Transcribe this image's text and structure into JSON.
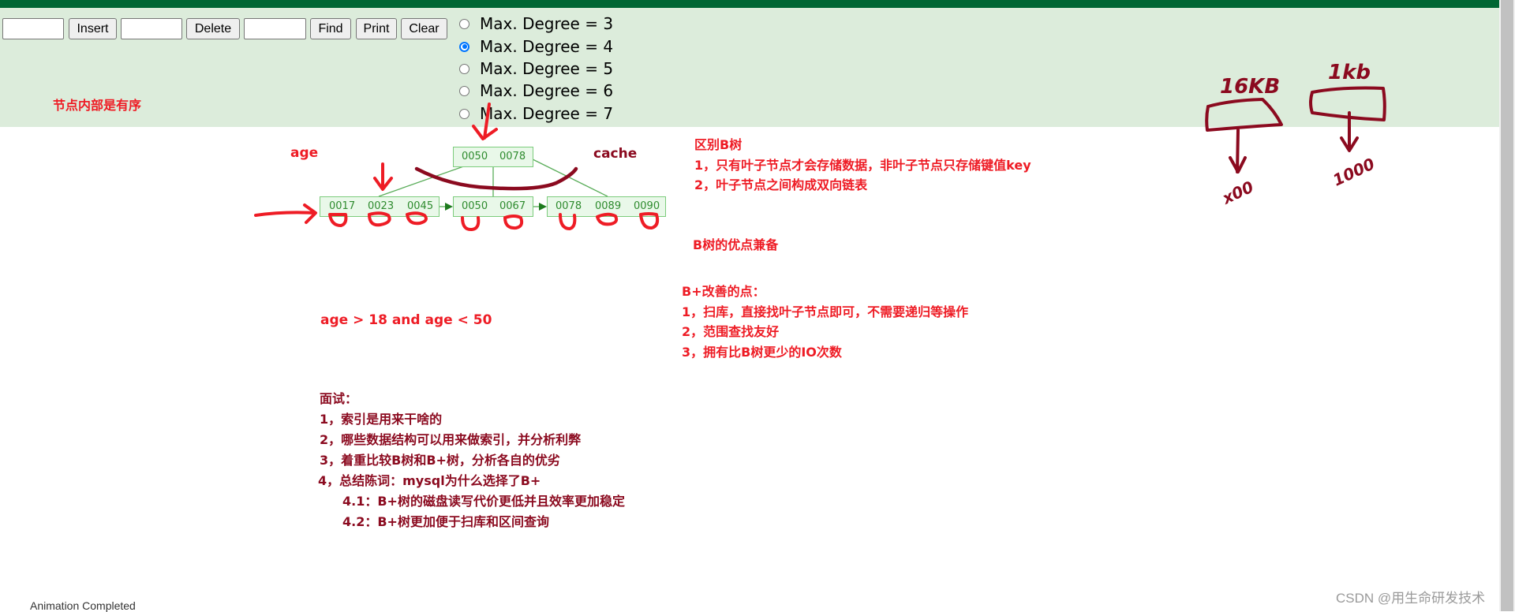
{
  "toolbar": {
    "insert_input_value": "",
    "insert_label": "Insert",
    "delete_input_value": "",
    "delete_label": "Delete",
    "find_input_value": "",
    "find_label": "Find",
    "print_label": "Print",
    "clear_label": "Clear"
  },
  "degree_options": [
    {
      "label": "Max. Degree = 3",
      "checked": false
    },
    {
      "label": "Max. Degree = 4",
      "checked": true
    },
    {
      "label": "Max. Degree = 5",
      "checked": false
    },
    {
      "label": "Max. Degree = 6",
      "checked": false
    },
    {
      "label": "Max. Degree = 7",
      "checked": false
    }
  ],
  "notes": {
    "node_sorted": "节点内部是有序",
    "age_label": "age",
    "cache_label": "cache",
    "range_query": "age > 18 and age < 50",
    "diff_title": "区别B树",
    "diff_lines": [
      "1，只有叶子节点才会存储数据，非叶子节点只存储键值key",
      "2，叶子节点之间构成双向链表"
    ],
    "b_tree_merits": "B树的优点兼备",
    "improve_title": "B+改善的点：",
    "improve_lines": [
      "1，扫库，直接找叶子节点即可，不需要递归等操作",
      "2，范围查找友好",
      "3，拥有比B树更少的IO次数"
    ],
    "interview_title": "面试：",
    "interview_lines": [
      "1，索引是用来干啥的",
      "2，哪些数据结构可以用来做索引，并分析利弊",
      "3，着重比较B树和B+树，分析各自的优劣",
      "4，总结陈词：mysql为什么选择了B+"
    ],
    "interview_sub_lines": [
      "4.1：B+树的磁盘读写代价更低并且效率更加稳定",
      "4.2：B+树更加便于扫库和区间查询"
    ]
  },
  "handwriting": {
    "left_box_label": "16KB",
    "left_box_count": "x00",
    "right_box_label": "1kb",
    "right_box_count": "1000"
  },
  "tree": {
    "root": [
      "0050",
      "0078"
    ],
    "leaves": [
      [
        "0017",
        "0023",
        "0045"
      ],
      [
        "0050",
        "0067"
      ],
      [
        "0078",
        "0089",
        "0090"
      ]
    ]
  },
  "status_text": "Animation Completed",
  "watermark": "CSDN @用生命研发技术",
  "colors": {
    "top_bar": "#006633",
    "panel": "#dcecdb",
    "note_red": "#ee1c25",
    "note_maroon": "#8b0a1f",
    "node_border": "#7ccc7c",
    "node_fill": "#e9f8e9",
    "radio_checked": "#0075ff"
  }
}
